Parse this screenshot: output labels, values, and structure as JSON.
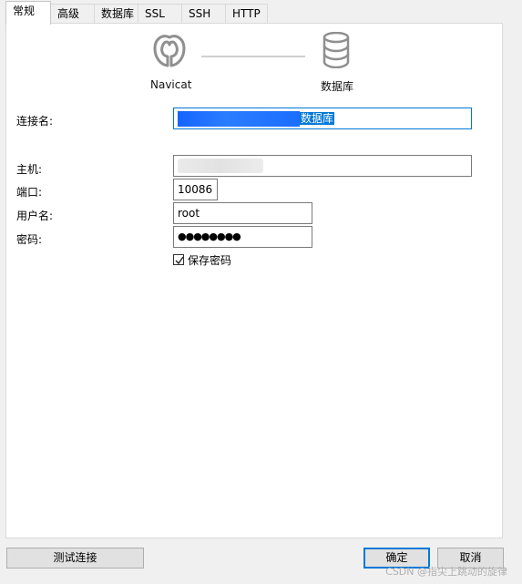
{
  "tabs": [
    {
      "label": "常规",
      "active": true
    },
    {
      "label": "高级"
    },
    {
      "label": "数据库"
    },
    {
      "label": "SSL"
    },
    {
      "label": "SSH"
    },
    {
      "label": "HTTP"
    }
  ],
  "diagram": {
    "source_label": "Navicat",
    "target_label": "数据库",
    "source_icon": "navicat-logo-icon",
    "target_icon": "database-icon"
  },
  "form": {
    "connection_name": {
      "label": "连接名:",
      "value_suffix": "数据库"
    },
    "host": {
      "label": "主机:"
    },
    "port": {
      "label": "端口:",
      "value": "10086"
    },
    "username": {
      "label": "用户名:",
      "value": "root"
    },
    "password": {
      "label": "密码:",
      "value": "●●●●●●●●"
    },
    "save_password": {
      "label": "保存密码",
      "checked": true
    }
  },
  "buttons": {
    "test_connection": "测试连接",
    "ok": "确定",
    "cancel": "取消"
  },
  "watermark": "CSDN @指尖上跳动的旋律",
  "colors": {
    "accent": "#0078d7",
    "selection": "#0078d7",
    "panel_bg": "#ffffff",
    "window_bg": "#f0f0f0"
  }
}
